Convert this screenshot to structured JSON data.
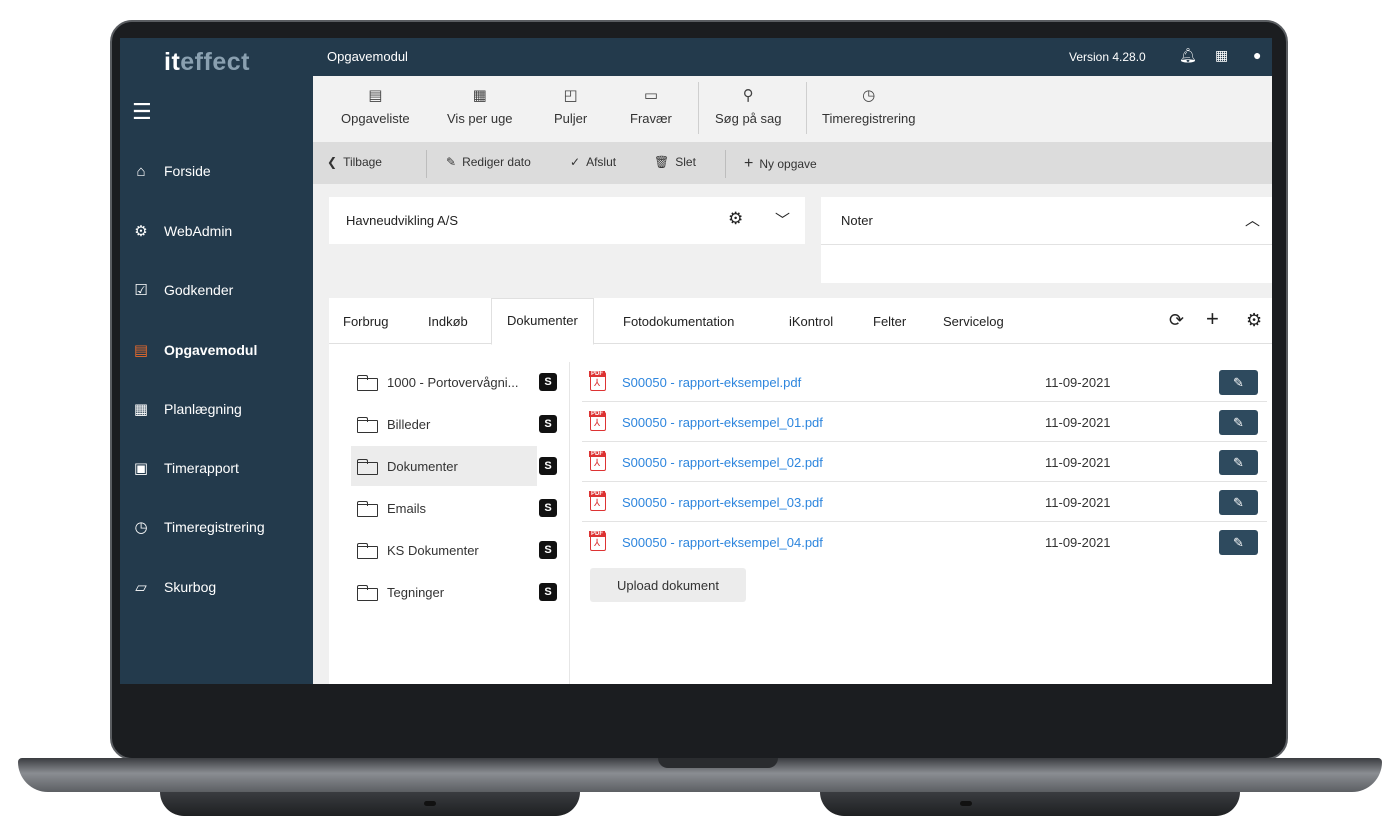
{
  "app": {
    "logo_it": "it",
    "logo_effect": "effect",
    "module_title": "Opgavemodul",
    "version": "Version 4.28.0"
  },
  "sidebar": {
    "items": [
      {
        "label": "Forside",
        "icon": "home-icon"
      },
      {
        "label": "WebAdmin",
        "icon": "gear-icon"
      },
      {
        "label": "Godkender",
        "icon": "checkbox-icon"
      },
      {
        "label": "Opgavemodul",
        "icon": "clipboard-icon",
        "active": true
      },
      {
        "label": "Planlægning",
        "icon": "calendar-icon"
      },
      {
        "label": "Timerapport",
        "icon": "timesheet-icon"
      },
      {
        "label": "Timeregistrering",
        "icon": "clock-icon"
      },
      {
        "label": "Skurbog",
        "icon": "notebook-icon"
      }
    ]
  },
  "toolbar": {
    "items": [
      {
        "label": "Opgaveliste",
        "icon": "list-icon"
      },
      {
        "label": "Vis per uge",
        "icon": "calendar-icon"
      },
      {
        "label": "Puljer",
        "icon": "pool-icon"
      },
      {
        "label": "Fravær",
        "icon": "absence-icon"
      },
      {
        "label": "Søg på sag",
        "icon": "search-icon"
      },
      {
        "label": "Timeregistrering",
        "icon": "clock-icon"
      }
    ]
  },
  "actionbar": {
    "back": "Tilbage",
    "edit_date": "Rediger dato",
    "finish": "Afslut",
    "delete": "Slet",
    "new_task": "Ny opgave"
  },
  "company_panel": {
    "name": "Havneudvikling A/S"
  },
  "notes_panel": {
    "title": "Noter"
  },
  "tabs": [
    "Forbrug",
    "Indkøb",
    "Dokumenter",
    "Fotodokumentation",
    "iKontrol",
    "Felter",
    "Servicelog"
  ],
  "active_tab": "Dokumenter",
  "folders": [
    {
      "label": "1000 - Portovervågni..."
    },
    {
      "label": "Billeder"
    },
    {
      "label": "Dokumenter",
      "selected": true
    },
    {
      "label": "Emails"
    },
    {
      "label": "KS Dokumenter"
    },
    {
      "label": "Tegninger"
    }
  ],
  "files": [
    {
      "name": "S00050 - rapport-eksempel.pdf",
      "date": "11-09-2021"
    },
    {
      "name": "S00050 - rapport-eksempel_01.pdf",
      "date": "11-09-2021"
    },
    {
      "name": "S00050 - rapport-eksempel_02.pdf",
      "date": "11-09-2021"
    },
    {
      "name": "S00050 - rapport-eksempel_03.pdf",
      "date": "11-09-2021"
    },
    {
      "name": "S00050 - rapport-eksempel_04.pdf",
      "date": "11-09-2021"
    }
  ],
  "upload_label": "Upload dokument",
  "colors": {
    "sidebar": "#233a4c",
    "accent": "#e86a2b",
    "link": "#2e86de",
    "edit_button": "#2e4a5e"
  }
}
